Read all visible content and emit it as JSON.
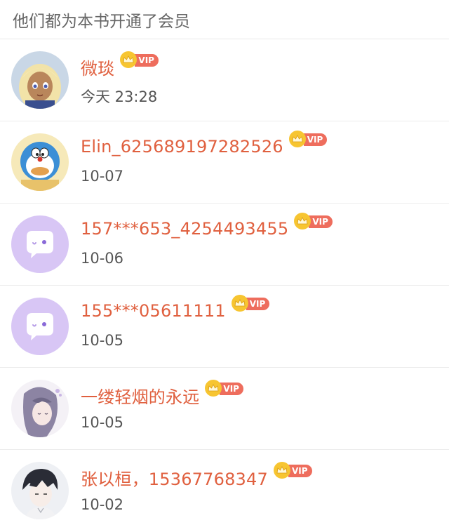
{
  "header": {
    "title": "他们都为本书开通了会员"
  },
  "members": [
    {
      "name": "微琰",
      "time": "今天 23:28",
      "badge": "VIP",
      "avatar": "anime-girl-blonde-avatar"
    },
    {
      "name": "Elin_625689197282526",
      "time": "10-07",
      "badge": "VIP",
      "avatar": "doraemon-avatar"
    },
    {
      "name": "157***653_4254493455",
      "time": "10-06",
      "badge": "VIP",
      "avatar": "default-chat-avatar"
    },
    {
      "name": "155***05611111",
      "time": "10-05",
      "badge": "VIP",
      "avatar": "default-chat-avatar"
    },
    {
      "name": "一缕轻烟的永远",
      "time": "10-05",
      "badge": "VIP",
      "avatar": "anime-girl-lavender-avatar"
    },
    {
      "name": "张以桓，15367768347",
      "time": "10-02",
      "badge": "VIP",
      "avatar": "anime-boy-avatar"
    }
  ],
  "colors": {
    "name": "#e0603f",
    "vip_label_bg": "#ee6d5d",
    "vip_crown": "#f7c531",
    "default_avatar_bg": "#d8c6f5"
  }
}
